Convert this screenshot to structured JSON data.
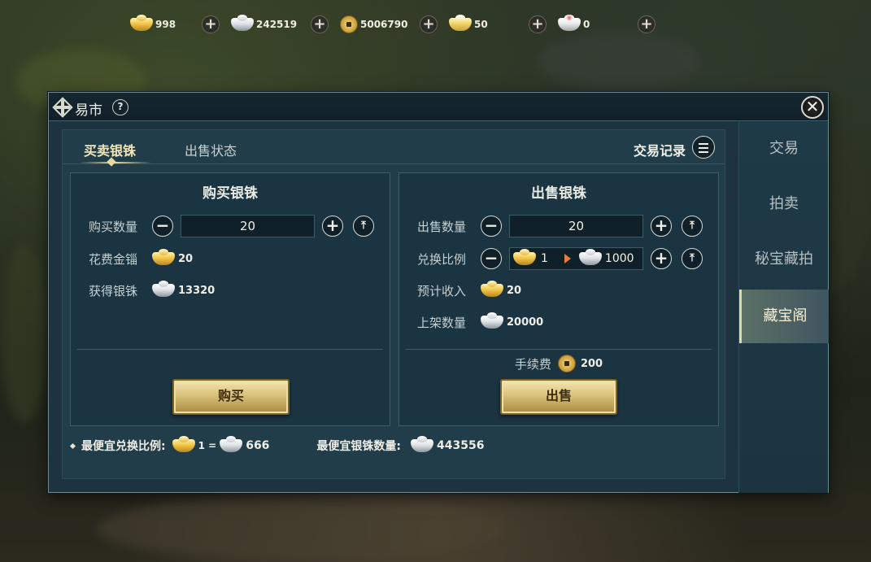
{
  "currency_bar": {
    "gold_ingot": "998",
    "silver_ingot": "242519",
    "copper_coin": "5006790",
    "gold_silver_ingot": "50",
    "special_ingot": "0",
    "plus_label": "+"
  },
  "window": {
    "title": "易市",
    "help_label": "?",
    "close_label": "✕"
  },
  "side_tabs": [
    {
      "label": "交易"
    },
    {
      "label": "拍卖"
    },
    {
      "label": "秘宝藏拍"
    },
    {
      "label": "藏宝阁",
      "active": true
    }
  ],
  "top_tabs": {
    "tab1": "买卖银铢",
    "tab2": "出售状态",
    "trade_log": "交易记录"
  },
  "buy_panel": {
    "title": "购买银铢",
    "quantity_label": "购买数量",
    "quantity_value": "20",
    "cost_label": "花费金锱",
    "cost_value": "20",
    "gain_label": "获得银铢",
    "gain_value": "13320",
    "button_label": "购买",
    "minus": "−",
    "plus": "+",
    "max": "⤒"
  },
  "sell_panel": {
    "title": "出售银铢",
    "quantity_label": "出售数量",
    "quantity_value": "20",
    "ratio_label": "兑换比例",
    "ratio_gold": "1",
    "ratio_silver": "1000",
    "income_label": "预计收入",
    "income_value": "20",
    "listed_label": "上架数量",
    "listed_value": "20000",
    "fee_label": "手续费",
    "fee_value": "200",
    "button_label": "出售",
    "minus": "−",
    "plus": "+",
    "max": "⤒"
  },
  "footer": {
    "best_ratio_label": "最便宜兑换比例:",
    "best_ratio_gold": "1 =",
    "best_ratio_silver": "666",
    "cheapest_qty_label": "最便宜银铢数量:",
    "cheapest_qty_value": "443556"
  },
  "colors": {
    "accent_gold": "#f3e6b6",
    "panel_bg": "#1a3442",
    "window_bg": "#1d3340"
  }
}
